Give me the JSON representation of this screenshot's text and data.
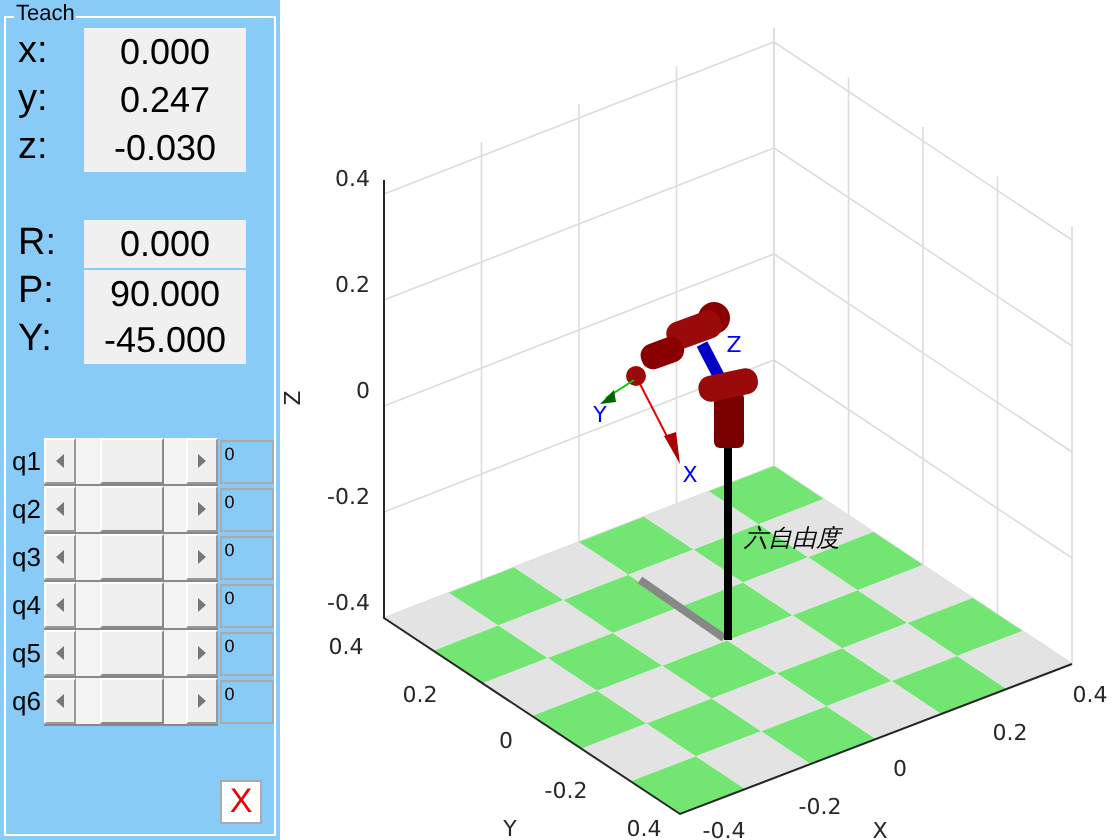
{
  "panel": {
    "title": "Teach",
    "position": [
      {
        "label": "x:",
        "value": "0.000"
      },
      {
        "label": "y:",
        "value": "0.247"
      },
      {
        "label": "z:",
        "value": "-0.030"
      }
    ],
    "orientation": [
      {
        "label": "R:",
        "value": "0.000"
      },
      {
        "label": "P:",
        "value": "90.000"
      },
      {
        "label": "Y:",
        "value": "-45.000"
      }
    ],
    "joints": [
      {
        "label": "q1",
        "level": 0.5,
        "value": "0"
      },
      {
        "label": "q2",
        "level": 0.5,
        "value": "0"
      },
      {
        "label": "q3",
        "level": 0.5,
        "value": "0"
      },
      {
        "label": "q4",
        "level": 0.5,
        "value": "0"
      },
      {
        "label": "q5",
        "level": 0.5,
        "value": "0"
      },
      {
        "label": "q6",
        "level": 0.5,
        "value": "0"
      }
    ],
    "close_button": "X"
  },
  "plot": {
    "z_label": "Z",
    "y_label": "Y",
    "x_label": "X",
    "z_ticks": [
      "0.4",
      "0.2",
      "0",
      "-0.2",
      "-0.4"
    ],
    "y_ticks": [
      "0.4",
      "0.2",
      "0",
      "-0.2",
      "0.4"
    ],
    "x_ticks": [
      "0.4",
      "0.2",
      "0",
      "-0.2",
      "-0.4"
    ],
    "frame_labels": [
      "X",
      "Y",
      "Z"
    ],
    "annotation": "六自由度"
  }
}
